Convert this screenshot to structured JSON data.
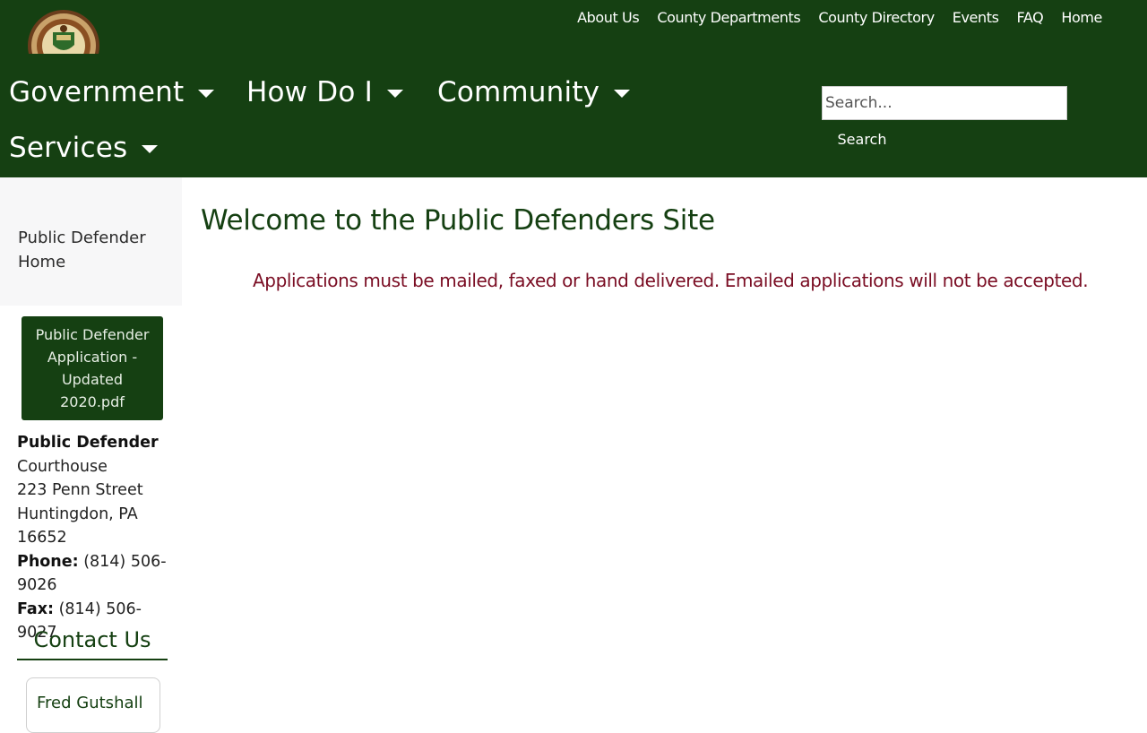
{
  "header": {
    "utility_nav": [
      "About Us",
      "County Departments",
      "County Directory",
      "Events",
      "FAQ",
      "Home"
    ],
    "main_nav": [
      "Government",
      "How Do I",
      "Community",
      "Services"
    ],
    "search": {
      "placeholder": "Search...",
      "button_label": "Search"
    }
  },
  "sidebar": {
    "home_link": "Public Defender Home",
    "application_button": "Public Defender Application - Updated 2020.pdf",
    "office_name": "Public Defender",
    "address_line1": "Courthouse",
    "address_line2": "223 Penn Street",
    "address_line3": "Huntingdon, PA  16652",
    "phone_label": "Phone:",
    "phone_value": " (814) 506-9026",
    "fax_label": "Fax:",
    "fax_value": " (814) 506-9027",
    "contact_title": "Contact Us",
    "contacts": [
      {
        "name": "Fred Gutshall"
      }
    ]
  },
  "main": {
    "title": "Welcome to the Public Defenders Site",
    "notice": "Applications must be mailed, faxed or hand delivered.  Emailed applications will not be accepted."
  },
  "colors": {
    "header_green": "#154012",
    "notice_red": "#7a0d23"
  }
}
